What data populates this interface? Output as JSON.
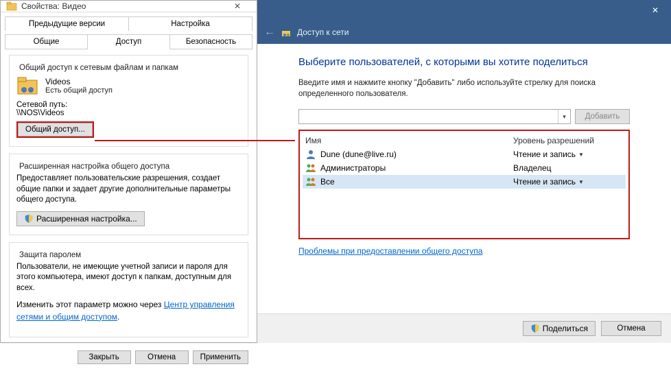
{
  "left": {
    "title": "Свойства: Видео",
    "tabs_top": [
      "Предыдущие версии",
      "Настройка"
    ],
    "tabs_bottom": [
      "Общие",
      "Доступ",
      "Безопасность"
    ],
    "group1_title": "Общий доступ к сетевым файлам и папкам",
    "folder_name": "Videos",
    "folder_sub": "Есть общий доступ",
    "path_label": "Сетевой путь:",
    "path_value": "\\\\NOS\\Videos",
    "share_btn": "Общий доступ...",
    "group2_title": "Расширенная настройка общего доступа",
    "group2_desc": "Предоставляет пользовательские разрешения, создает общие папки и задает другие дополнительные параметры общего доступа.",
    "adv_btn": "Расширенная настройка...",
    "group3_title": "Защита паролем",
    "group3_desc": "Пользователи, не имеющие учетной записи и пароля для этого компьютера, имеют доступ к папкам, доступным для всех.",
    "group3_desc2a": "Изменить этот параметр можно через ",
    "group3_link": "Центр управления сетями и общим доступом",
    "footer": {
      "close": "Закрыть",
      "cancel": "Отмена",
      "apply": "Применить"
    }
  },
  "right": {
    "nav_title": "Доступ к сети",
    "heading": "Выберите пользователей, с которыми вы хотите поделиться",
    "instr": "Введите имя и нажмите кнопку \"Добавить\" либо используйте стрелку для поиска определенного пользователя.",
    "add_btn": "Добавить",
    "col_name": "Имя",
    "col_perm": "Уровень разрешений",
    "rows": [
      {
        "name": "Dune  (dune@live.ru)",
        "perm": "Чтение и запись",
        "caret": true,
        "icon": "user",
        "selected": false
      },
      {
        "name": "Администраторы",
        "perm": "Владелец",
        "caret": false,
        "icon": "group",
        "selected": false
      },
      {
        "name": "Все",
        "perm": "Чтение и запись",
        "caret": true,
        "icon": "group",
        "selected": true
      }
    ],
    "trouble_link": "Проблемы при предоставлении общего доступа",
    "footer": {
      "share": "Поделиться",
      "cancel": "Отмена"
    }
  }
}
